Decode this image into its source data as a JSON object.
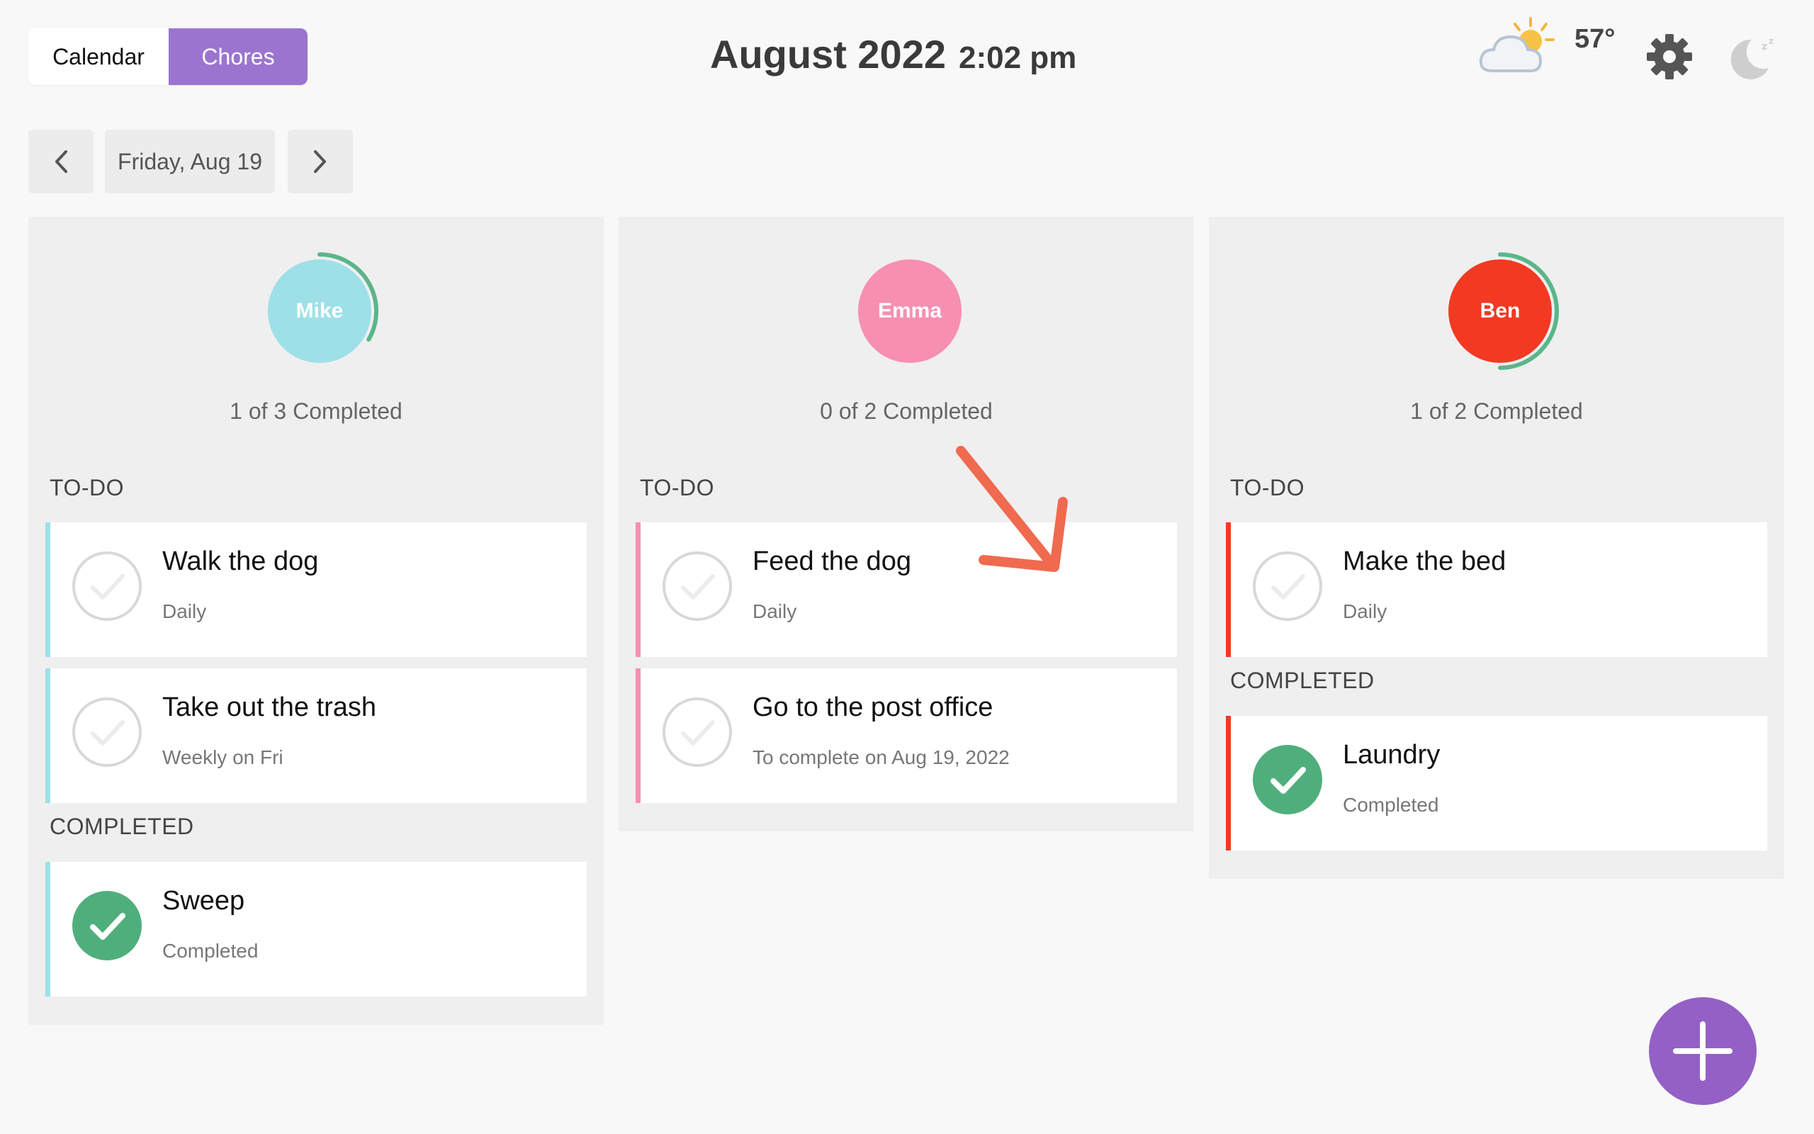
{
  "header": {
    "tabs": [
      {
        "label": "Calendar",
        "active": false
      },
      {
        "label": "Chores",
        "active": true
      }
    ],
    "month": "August 2022",
    "time": "2:02 pm",
    "weather": {
      "temp": "57°",
      "icon": "partly-cloudy-icon"
    },
    "icons": [
      "gear-icon",
      "moon-sleep-icon"
    ]
  },
  "date_nav": {
    "label": "Friday, Aug 19"
  },
  "colors": {
    "accent": "#9b74cf",
    "progress": "#5bb58a",
    "mike": "#9ee0e8",
    "emma": "#f78fb1",
    "ben": "#f23a22",
    "check_done": "#4faf7c"
  },
  "people": [
    {
      "name": "Mike",
      "progress": "1 of 3 Completed",
      "completed": 1,
      "total": 3,
      "todo_label": "TO-DO",
      "todo": [
        {
          "name": "Walk the dog",
          "sub": "Daily"
        },
        {
          "name": "Take out the trash",
          "sub": "Weekly on Fri"
        }
      ],
      "completed_label": "COMPLETED",
      "done": [
        {
          "name": "Sweep",
          "sub": "Completed"
        }
      ]
    },
    {
      "name": "Emma",
      "progress": "0 of 2 Completed",
      "completed": 0,
      "total": 2,
      "todo_label": "TO-DO",
      "todo": [
        {
          "name": "Feed the dog",
          "sub": "Daily"
        },
        {
          "name": "Go to the post office",
          "sub": "To complete on Aug 19, 2022"
        }
      ],
      "done": []
    },
    {
      "name": "Ben",
      "progress": "1 of 2 Completed",
      "completed": 1,
      "total": 2,
      "todo_label": "TO-DO",
      "todo": [
        {
          "name": "Make the bed",
          "sub": "Daily"
        }
      ],
      "completed_label": "COMPLETED",
      "done": [
        {
          "name": "Laundry",
          "sub": "Completed"
        }
      ]
    }
  ]
}
